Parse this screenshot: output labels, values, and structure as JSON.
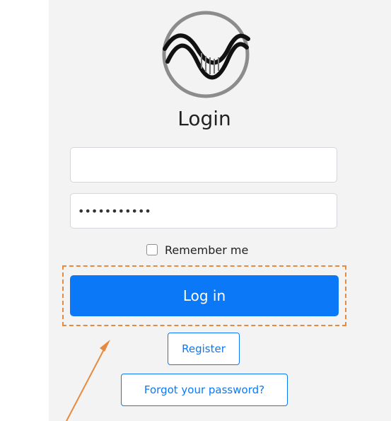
{
  "page": {
    "title": "Login",
    "logo_icon": "dna-logo-icon"
  },
  "form": {
    "username": {
      "value": "",
      "placeholder": ""
    },
    "password": {
      "value": "•••••••••••",
      "placeholder": ""
    },
    "remember_label": "Remember me",
    "remember_checked": false,
    "login_label": "Log in",
    "register_label": "Register",
    "forgot_label": "Forgot your password?"
  },
  "annotation": {
    "highlight_color": "#e58a3e",
    "arrow_color": "#e58a3e"
  },
  "colors": {
    "primary": "#0b79f7",
    "panel_background": "#f3f3f3"
  }
}
